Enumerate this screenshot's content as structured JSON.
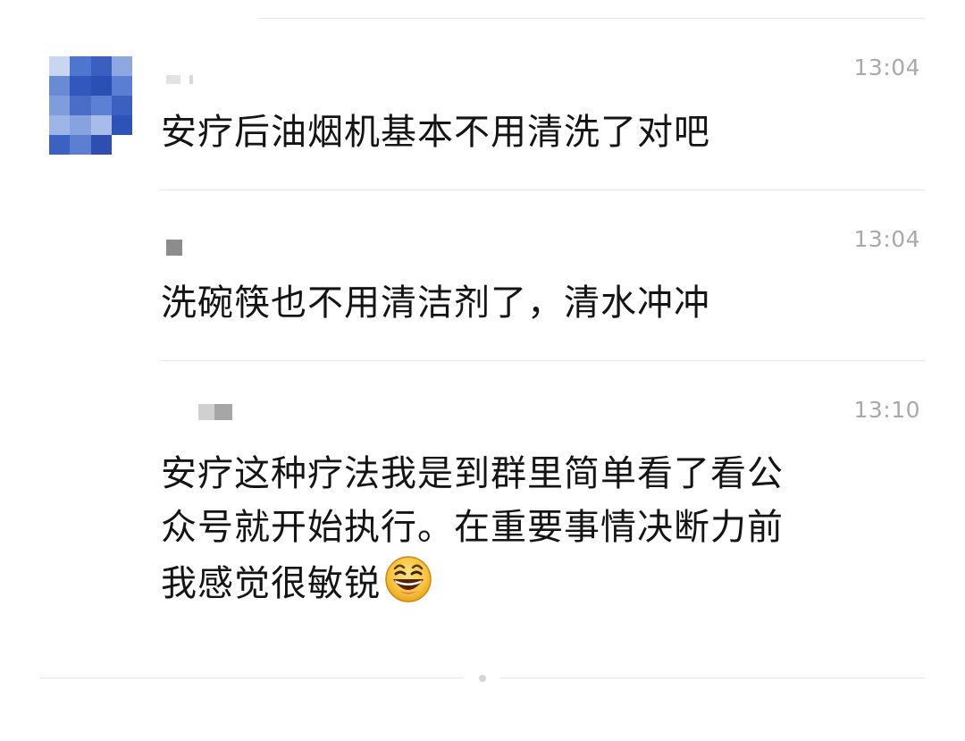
{
  "messages": [
    {
      "time": "13:04",
      "text": "安疗后油烟机基本不用清洗了对吧"
    },
    {
      "time": "13:04",
      "text": "洗碗筷也不用清洁剂了，清水冲冲"
    },
    {
      "time": "13:10",
      "text": "安疗这种疗法我是到群里简单看了看公\n众号就开始执行。在重要事情决断力前\n我感觉很敏锐",
      "emoji": "grinning-face-icon"
    }
  ],
  "colors": {
    "time": "#a9a9a9",
    "text": "#141414",
    "divider": "#e4e4e4",
    "avatar_blue": "#3d63c4",
    "emoji_yellow": "#f7c23b"
  }
}
